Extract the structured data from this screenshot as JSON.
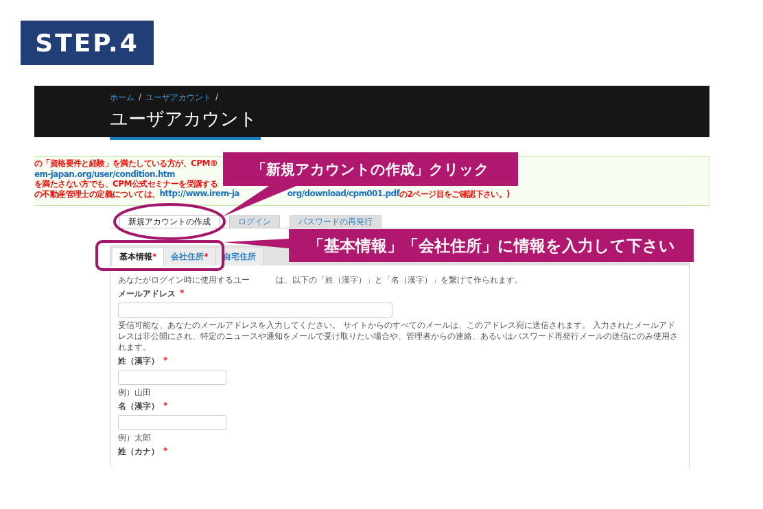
{
  "step_badge": "STEP.4",
  "breadcrumb": [
    {
      "label": "ホーム",
      "kind": "link"
    },
    {
      "label": "/",
      "kind": "separator"
    },
    {
      "label": "ユーザアカウント",
      "kind": "link"
    },
    {
      "label": "/",
      "kind": "separator"
    }
  ],
  "page_title": "ユーザアカウント",
  "notice": {
    "lines": [
      {
        "parts": [
          [
            {
              "kind": "text",
              "text": "の「資格要件と経験」を満たしている方が、CPM®"
            }
          ]
        ]
      },
      {
        "parts": [
          [
            {
              "kind": "link",
              "text": "em-japan.org/user/condition.htm"
            }
          ]
        ]
      },
      {
        "parts": [
          [
            {
              "kind": "text",
              "text": "を満たさない方でも、CPM公式セミナーを受講する"
            }
          ]
        ]
      },
      {
        "parts": [
          [
            {
              "kind": "text",
              "text": "の不動産管理士の定義については、"
            },
            {
              "kind": "link",
              "text": "http://www.irem-ja"
            }
          ],
          [
            {
              "kind": "link",
              "text": "org/download/cpm001.pdf"
            },
            {
              "kind": "text",
              "text": "の2ページ目をご確認下さい。)"
            }
          ]
        ]
      }
    ]
  },
  "account_tabs": [
    {
      "label": "新規アカウントの作成",
      "selected": true
    },
    {
      "label": "ログイン",
      "selected": false
    },
    {
      "label": "パスワードの再発行",
      "selected": false
    }
  ],
  "form_tabs": [
    {
      "label": "基本情報",
      "mark": "*",
      "selected": true
    },
    {
      "label": "会社住所",
      "mark": "*",
      "selected": false
    },
    {
      "label": "自宅住所",
      "selected": false
    }
  ],
  "intro_parts": [
    "あなたがログイン時に使用するユー",
    "は、以下の「姓（漢字）」と「名（漢字）」を繋げて作られます。"
  ],
  "fields": [
    {
      "label": "メールアドレス",
      "mark": "*",
      "kind": "wide",
      "help": "受信可能な、あなたのメールアドレスを入力してください。 サイトからのすべてのメールは、このアドレス宛に送信されます。 入力されたメールアドレスは非公開にされ、特定のニュースや通知をメールで受け取りたい場合や、管理者からの連絡、あるいはパスワード再発行メールの送信にのみ使用されます。"
    },
    {
      "label": "姓（漢字）",
      "mark": "*",
      "kind": "narrow",
      "help": "例）山田"
    },
    {
      "label": "名（漢字）",
      "mark": "*",
      "kind": "narrow",
      "help": "例）太郎"
    },
    {
      "label": "姓（カナ）",
      "mark": "*",
      "kind": "label_only"
    }
  ],
  "callouts": [
    {
      "text": "「新規アカウントの作成」クリック"
    },
    {
      "text": "「基本情報」「会社住所」に情報を入力して下さい"
    }
  ]
}
